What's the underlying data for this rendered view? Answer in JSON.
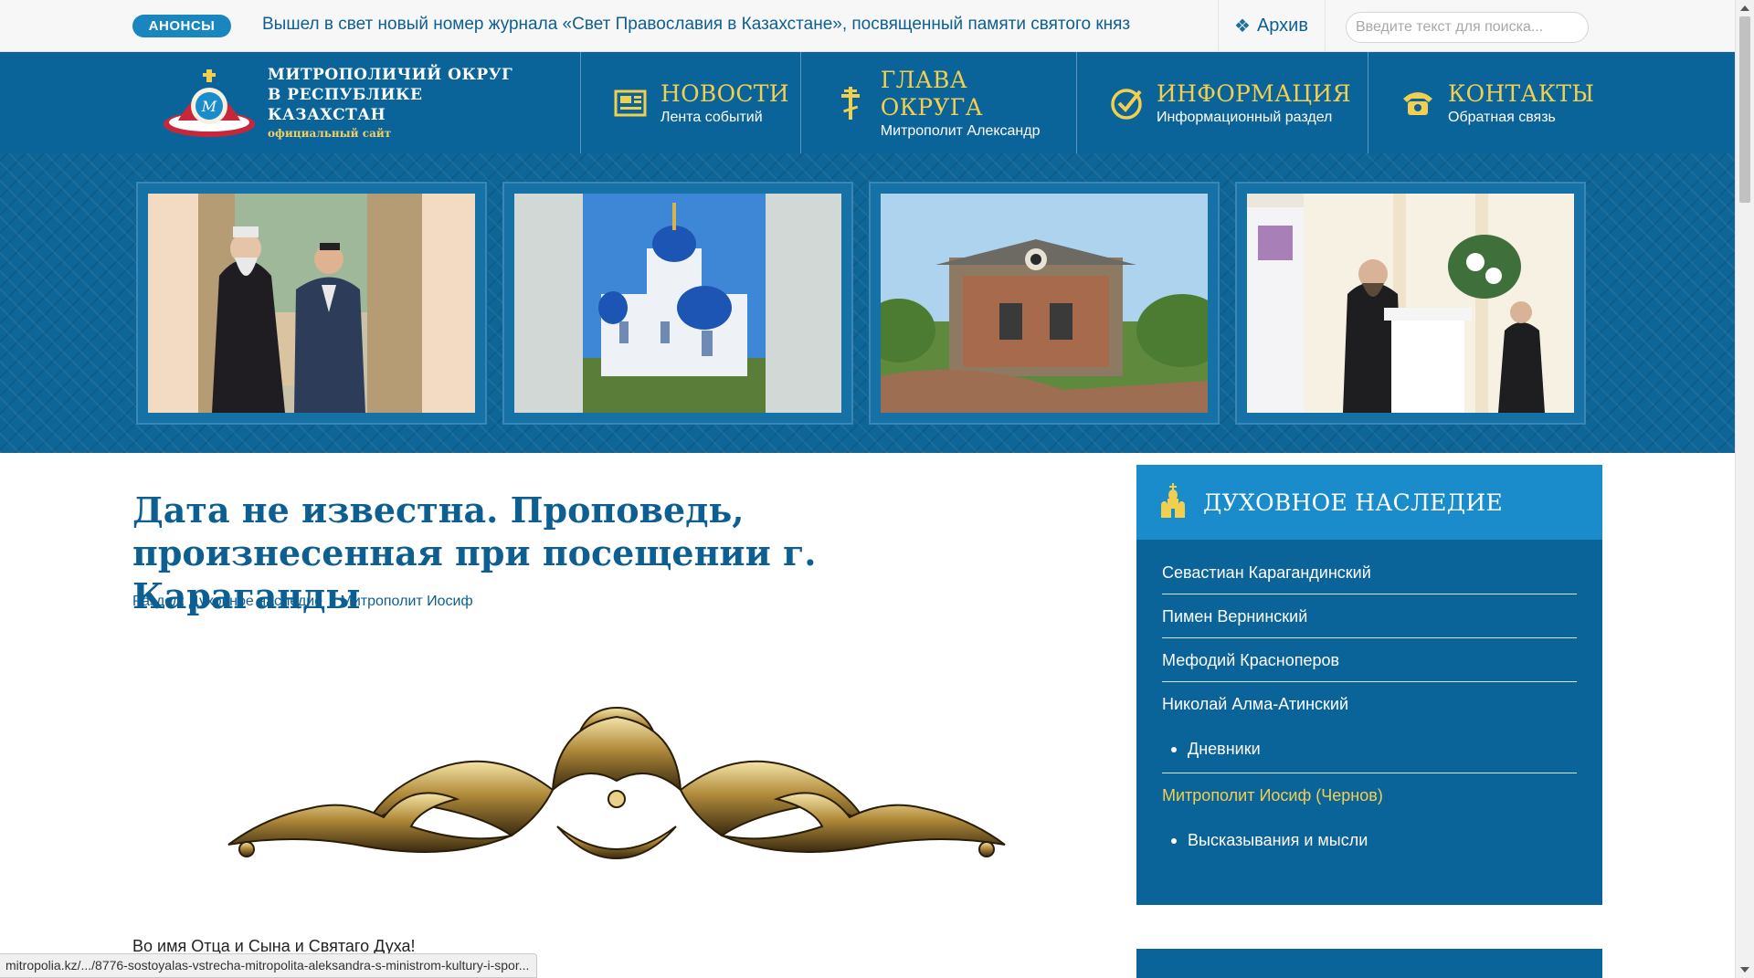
{
  "topbar": {
    "badge": "АНОНСЫ",
    "ticker": "Вышел в свет новый номер журнала «Свет Православия в Казахстане», посвященный памяти святого княз",
    "archive_label": "Архив",
    "search_placeholder": "Введите текст для поиска..."
  },
  "logo": {
    "line1": "МИТРОПОЛИЧИЙ ОКРУГ",
    "line2": "В РЕСПУБЛИКЕ КАЗАХСТАН",
    "line3": "официальный сайт"
  },
  "nav": [
    {
      "title": "НОВОСТИ",
      "subtitle": "Лента событий",
      "icon": "newspaper-icon"
    },
    {
      "title": "ГЛАВА ОКРУГА",
      "subtitle": "Митрополит Александр",
      "icon": "cross-icon"
    },
    {
      "title": "ИНФОРМАЦИЯ",
      "subtitle": "Информационный раздел",
      "icon": "check-circle-icon"
    },
    {
      "title": "КОНТАКТЫ",
      "subtitle": "Обратная связь",
      "icon": "telephone-icon"
    }
  ],
  "banner": {
    "slides": [
      {
        "alt": "meeting-photo"
      },
      {
        "alt": "blue-church-photo"
      },
      {
        "alt": "old-church-ruins-photo"
      },
      {
        "alt": "conference-photo"
      }
    ]
  },
  "article": {
    "title": "Дата не известна. Проповедь, произнесенная при посещении г. Караганды",
    "meta_section": "Раздел: Духовное наследие",
    "meta_tag": "Митрополит Иосиф",
    "first_line": "Во имя Отца и Сына и Святаго Духа!"
  },
  "sidebar": {
    "title": "ДУХОВНОЕ НАСЛЕДИЕ",
    "items": [
      {
        "label": "Севастиан Карагандинский"
      },
      {
        "label": "Пимен Вернинский"
      },
      {
        "label": "Мефодий Краснoперов"
      },
      {
        "label": "Николай Алма-Атинский"
      }
    ],
    "sub1": "Дневники",
    "active_item": "Митрополит Иосиф (Чернов)",
    "sub2": "Высказывания и мысли"
  },
  "status_url": "mitropolia.kz/.../8776-sostoyalas-vstrecha-mitropolita-aleksandra-s-ministrom-kultury-i-spor...",
  "colors": {
    "brand": "#0b6499",
    "accent": "#f2cf4e",
    "sidebar_head": "#1a8ccb",
    "badge": "#1a86bf"
  }
}
